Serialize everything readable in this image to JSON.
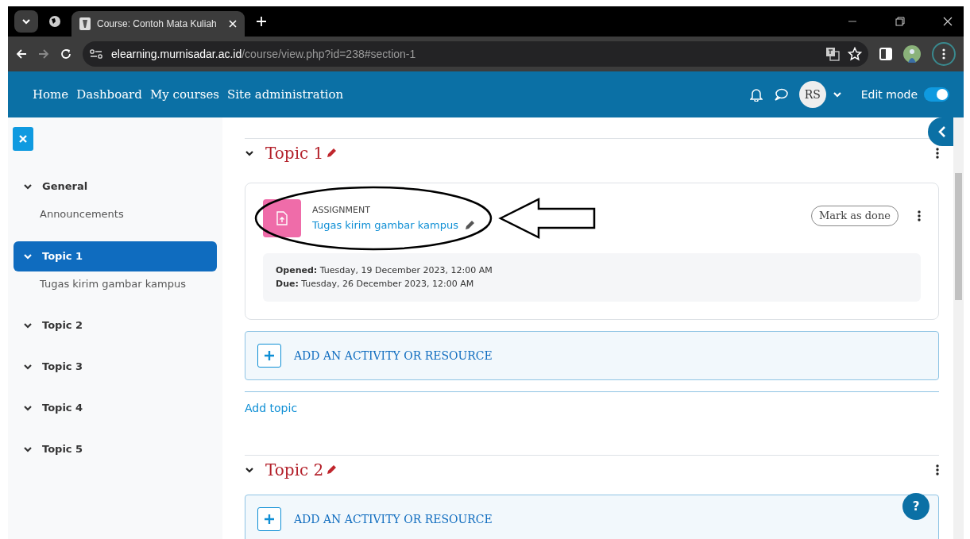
{
  "browser": {
    "tabs": [
      {
        "title": "Course: Contoh Mata Kuliah",
        "selected": true
      }
    ],
    "address": {
      "host": "elearning.murnisadar.ac.id",
      "path": "/course/view.php?id=238#section-1"
    }
  },
  "navbar": {
    "links": [
      "Home",
      "Dashboard",
      "My courses",
      "Site administration"
    ],
    "user_initials": "RS",
    "edit_mode": {
      "label": "Edit mode",
      "on": true
    }
  },
  "sidebar": {
    "items": [
      {
        "label": "General",
        "selected": false,
        "expanded": true,
        "children": [
          {
            "label": "Announcements"
          }
        ]
      },
      {
        "label": "Topic 1",
        "selected": true,
        "expanded": true,
        "children": [
          {
            "label": "Tugas kirim gambar kampus"
          }
        ]
      },
      {
        "label": "Topic 2",
        "selected": false,
        "expanded": true
      },
      {
        "label": "Topic 3",
        "selected": false,
        "expanded": true
      },
      {
        "label": "Topic 4",
        "selected": false,
        "expanded": true
      },
      {
        "label": "Topic 5",
        "selected": false,
        "expanded": true
      }
    ]
  },
  "sections": [
    {
      "title": "Topic 1",
      "activities": [
        {
          "type_label": "ASSIGNMENT",
          "name": "Tugas kirim gambar kampus",
          "button": "Mark as done",
          "dates": [
            {
              "label": "Opened:",
              "value": "Tuesday, 19 December 2023, 12:00 AM"
            },
            {
              "label": "Due:",
              "value": "Tuesday, 26 December 2023, 12:00 AM"
            }
          ]
        }
      ],
      "add_activity": "ADD AN ACTIVITY OR RESOURCE",
      "add_topic": "Add topic"
    },
    {
      "title": "Topic 2",
      "add_activity": "ADD AN ACTIVITY OR RESOURCE"
    }
  ],
  "help_button": "?"
}
